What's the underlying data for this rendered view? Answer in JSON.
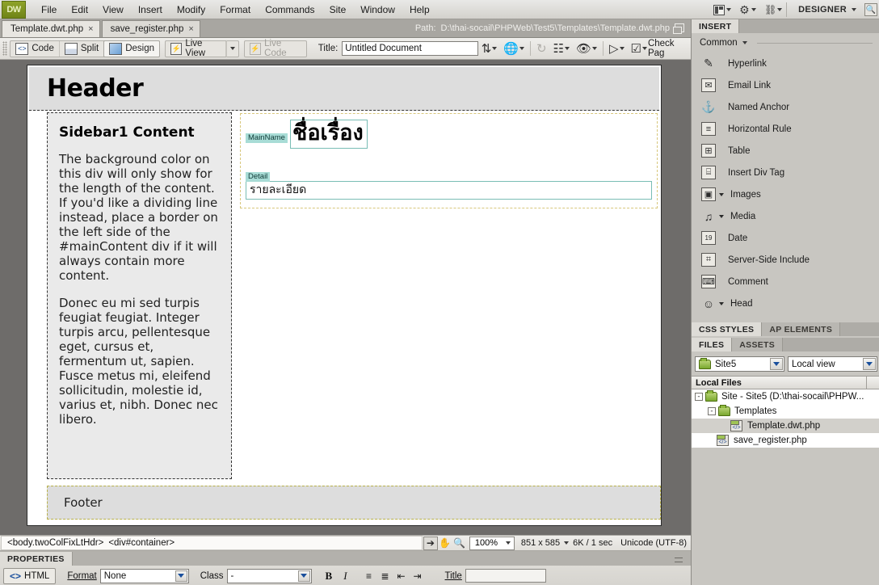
{
  "app": {
    "logo": "DW",
    "menu": [
      "File",
      "Edit",
      "View",
      "Insert",
      "Modify",
      "Format",
      "Commands",
      "Site",
      "Window",
      "Help"
    ],
    "workspace_label": "DESIGNER"
  },
  "tabs": [
    {
      "label": "Template.dwt.php",
      "close": "×",
      "active": true
    },
    {
      "label": "save_register.php",
      "close": "×",
      "active": false
    }
  ],
  "path": {
    "label": "Path:",
    "value": "D:\\thai-socail\\PHPWeb\\Test5\\Templates\\Template.dwt.php"
  },
  "toolbar": {
    "code": "Code",
    "split": "Split",
    "design": "Design",
    "live_view": "Live View",
    "live_code": "Live Code",
    "title_label": "Title:",
    "title_value": "Untitled Document",
    "check_page": "Check Pag"
  },
  "canvas": {
    "header": "Header",
    "sidebar_title": "Sidebar1 Content",
    "sidebar_p1": "The background color on this div will only show for the length of the content. If you'd like a dividing line instead, place a border on the left side of the #mainContent div if it will always contain more content.",
    "sidebar_p2": "Donec eu mi sed turpis feugiat feugiat. Integer turpis arcu, pellentesque eget, cursus et, fermentum ut, sapien. Fusce metus mi, eleifend sollicitudin, molestie id, varius et, nibh. Donec nec libero.",
    "editable_region_1_name": "MainName",
    "editable_region_1_text": "ชื่อเรื่อง",
    "editable_region_2_name": "Detail",
    "editable_region_2_text": "รายละเอียด",
    "footer": "Footer"
  },
  "statusbar": {
    "tag_selector": [
      "<body.twoColFixLtHdr>",
      "<div#container>"
    ],
    "zoom": "100%",
    "window_size": "851 x 585",
    "doc_size": "6K / 1 sec",
    "encoding": "Unicode (UTF-8)"
  },
  "properties": {
    "tab_label": "PROPERTIES",
    "html_button": "HTML",
    "format_label": "Format",
    "format_value": "None",
    "class_label": "Class",
    "class_value": "-",
    "bold": "B",
    "italic": "I",
    "title_label": "Title",
    "title_value": ""
  },
  "insert_panel": {
    "tab": "INSERT",
    "category": "Common",
    "items": [
      {
        "label": "Hyperlink",
        "icon": "hyperlink-icon",
        "glyph": "✎",
        "has_arrow": false,
        "bordered": false
      },
      {
        "label": "Email Link",
        "icon": "email-link-icon",
        "glyph": "✉",
        "has_arrow": false,
        "bordered": true
      },
      {
        "label": "Named Anchor",
        "icon": "named-anchor-icon",
        "glyph": "⚓",
        "has_arrow": false,
        "bordered": false
      },
      {
        "label": "Horizontal Rule",
        "icon": "horizontal-rule-icon",
        "glyph": "≡",
        "has_arrow": false,
        "bordered": true
      },
      {
        "label": "Table",
        "icon": "table-icon",
        "glyph": "⊞",
        "has_arrow": false,
        "bordered": true
      },
      {
        "label": "Insert Div Tag",
        "icon": "insert-div-tag-icon",
        "glyph": "⌸",
        "has_arrow": false,
        "bordered": true
      },
      {
        "label": "Images",
        "icon": "images-icon",
        "glyph": "▣",
        "has_arrow": true,
        "bordered": true
      },
      {
        "label": "Media",
        "icon": "media-icon",
        "glyph": "♫",
        "has_arrow": true,
        "bordered": false
      },
      {
        "label": "Date",
        "icon": "date-icon",
        "glyph": "19",
        "has_arrow": false,
        "bordered": true
      },
      {
        "label": "Server-Side Include",
        "icon": "server-side-include-icon",
        "glyph": "⌗",
        "has_arrow": false,
        "bordered": true
      },
      {
        "label": "Comment",
        "icon": "comment-icon",
        "glyph": "⌨",
        "has_arrow": false,
        "bordered": true
      },
      {
        "label": "Head",
        "icon": "head-icon",
        "glyph": "☺",
        "has_arrow": true,
        "bordered": false
      }
    ]
  },
  "css_panel": {
    "tab_css_styles": "CSS STYLES",
    "tab_ap_elements": "AP ELEMENTS"
  },
  "files_panel": {
    "tab_files": "FILES",
    "tab_assets": "ASSETS",
    "site_name": "Site5",
    "view_mode": "Local view",
    "column_header": "Local Files",
    "tree": [
      {
        "label": "Site - Site5 (D:\\thai-socail\\PHPW...",
        "depth": 0,
        "type": "folder",
        "expander": "-",
        "selected": false
      },
      {
        "label": "Templates",
        "depth": 1,
        "type": "folder",
        "expander": "-",
        "selected": false
      },
      {
        "label": "Template.dwt.php",
        "depth": 2,
        "type": "php",
        "expander": "",
        "selected": true
      },
      {
        "label": "save_register.php",
        "depth": 1,
        "type": "php",
        "expander": "",
        "selected": false
      }
    ]
  },
  "colors": {
    "accent_teal": "#a8dcd6",
    "panel_bg": "#c8c6c1",
    "canvas_bg": "#6e6c6a",
    "template_border": "#b8b14a"
  }
}
